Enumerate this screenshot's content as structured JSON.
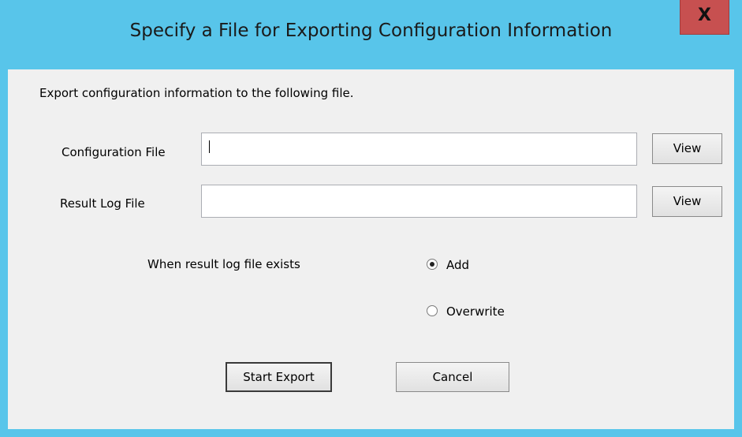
{
  "window": {
    "title": "Specify a File for Exporting Configuration Information",
    "close_glyph": "X"
  },
  "dialog": {
    "instruction": "Export configuration information to the following file.",
    "config_file": {
      "label": "Configuration File",
      "value": "",
      "view_label": "View"
    },
    "result_log_file": {
      "label": "Result Log File",
      "value": "",
      "view_label": "View"
    },
    "exists_option": {
      "label": "When result log file exists",
      "options": [
        {
          "label": "Add",
          "selected": true
        },
        {
          "label": "Overwrite",
          "selected": false
        }
      ]
    },
    "buttons": {
      "start_export": "Start Export",
      "cancel": "Cancel"
    }
  },
  "colors": {
    "frame": "#58c5ea",
    "client": "#f0f0f0",
    "close_button": "#c75050"
  }
}
